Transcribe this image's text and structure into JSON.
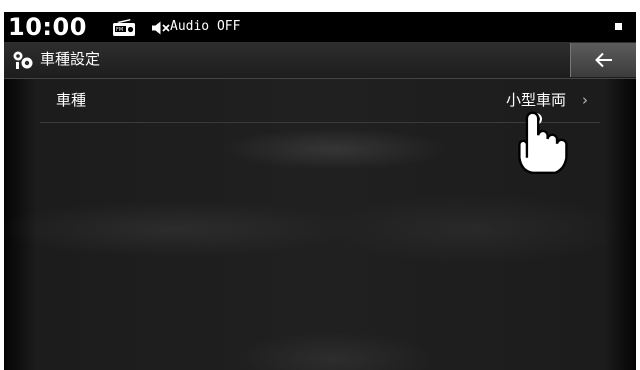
{
  "status_bar": {
    "time": "10:00",
    "radio_icon": "radio-icon",
    "mute_icon": "speaker-mute-icon",
    "audio_status": "Audio OFF",
    "signal_icon": "signal-icon"
  },
  "header": {
    "title": "車種設定",
    "title_icon": "gear-icon",
    "back_icon": "back-arrow-icon"
  },
  "settings": [
    {
      "label": "車種",
      "value": "小型車両",
      "chevron": "›"
    }
  ],
  "overlay": {
    "icon": "touch-hand-icon"
  }
}
